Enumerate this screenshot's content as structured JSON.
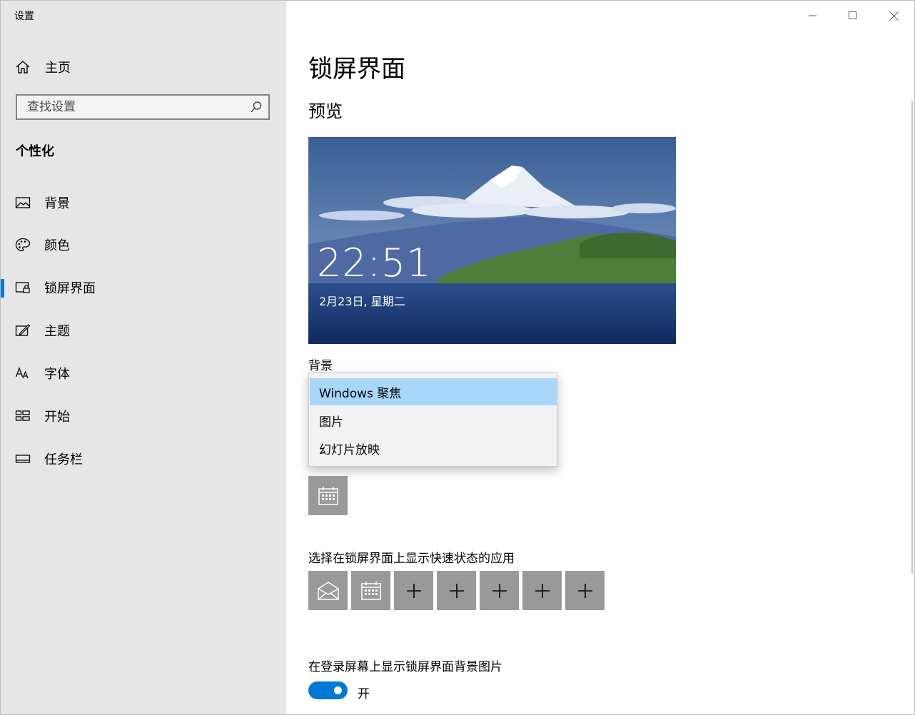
{
  "window": {
    "title": "设置"
  },
  "sidebar": {
    "home_label": "主页",
    "search_placeholder": "查找设置",
    "section_title": "个性化",
    "items": [
      {
        "label": "背景",
        "icon": "picture-icon"
      },
      {
        "label": "颜色",
        "icon": "palette-icon"
      },
      {
        "label": "锁屏界面",
        "icon": "lock-screen-icon",
        "selected": true
      },
      {
        "label": "主题",
        "icon": "theme-icon"
      },
      {
        "label": "字体",
        "icon": "font-icon"
      },
      {
        "label": "开始",
        "icon": "start-icon"
      },
      {
        "label": "任务栏",
        "icon": "taskbar-icon"
      }
    ]
  },
  "main": {
    "page_title": "锁屏界面",
    "preview_title": "预览",
    "preview": {
      "time": "22:51",
      "date": "2月23日, 星期二"
    },
    "background_label": "背景",
    "background_options": [
      "Windows 聚焦",
      "图片",
      "幻灯片放映"
    ],
    "background_selected": "Windows 聚焦",
    "quick_status_label": "选择在锁屏界面上显示快速状态的应用",
    "signin_bg_label": "在登录屏幕上显示锁屏界面背景图片",
    "signin_bg_state": "开",
    "signin_bg_on": true
  },
  "colors": {
    "accent": "#0078d7",
    "sidebar_bg": "#e6e6e6",
    "tile_bg": "#999999",
    "dropdown_selected": "#a9d6fb"
  }
}
